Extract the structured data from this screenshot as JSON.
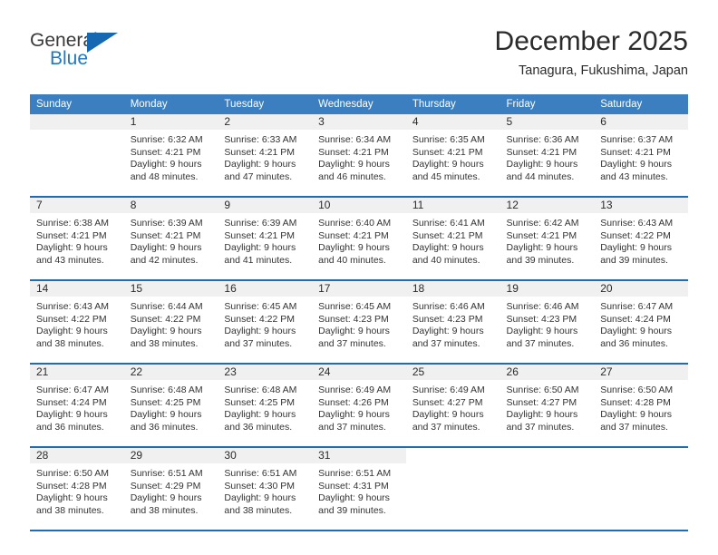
{
  "brand": {
    "name_part1": "General",
    "name_part2": "Blue",
    "logo_icon": "triangle-flag-icon"
  },
  "header": {
    "title": "December 2025",
    "subtitle": "Tanagura, Fukushima, Japan"
  },
  "colors": {
    "header_blue": "#3c7fc1",
    "row_divider_blue": "#1f6cb0",
    "daynum_band": "#f0f0f0",
    "brand_blue": "#1f78c1"
  },
  "weekday_headers": [
    "Sunday",
    "Monday",
    "Tuesday",
    "Wednesday",
    "Thursday",
    "Friday",
    "Saturday"
  ],
  "weeks": [
    [
      {
        "day": "",
        "lines": []
      },
      {
        "day": "1",
        "lines": [
          "Sunrise: 6:32 AM",
          "Sunset: 4:21 PM",
          "Daylight: 9 hours",
          "and 48 minutes."
        ]
      },
      {
        "day": "2",
        "lines": [
          "Sunrise: 6:33 AM",
          "Sunset: 4:21 PM",
          "Daylight: 9 hours",
          "and 47 minutes."
        ]
      },
      {
        "day": "3",
        "lines": [
          "Sunrise: 6:34 AM",
          "Sunset: 4:21 PM",
          "Daylight: 9 hours",
          "and 46 minutes."
        ]
      },
      {
        "day": "4",
        "lines": [
          "Sunrise: 6:35 AM",
          "Sunset: 4:21 PM",
          "Daylight: 9 hours",
          "and 45 minutes."
        ]
      },
      {
        "day": "5",
        "lines": [
          "Sunrise: 6:36 AM",
          "Sunset: 4:21 PM",
          "Daylight: 9 hours",
          "and 44 minutes."
        ]
      },
      {
        "day": "6",
        "lines": [
          "Sunrise: 6:37 AM",
          "Sunset: 4:21 PM",
          "Daylight: 9 hours",
          "and 43 minutes."
        ]
      }
    ],
    [
      {
        "day": "7",
        "lines": [
          "Sunrise: 6:38 AM",
          "Sunset: 4:21 PM",
          "Daylight: 9 hours",
          "and 43 minutes."
        ]
      },
      {
        "day": "8",
        "lines": [
          "Sunrise: 6:39 AM",
          "Sunset: 4:21 PM",
          "Daylight: 9 hours",
          "and 42 minutes."
        ]
      },
      {
        "day": "9",
        "lines": [
          "Sunrise: 6:39 AM",
          "Sunset: 4:21 PM",
          "Daylight: 9 hours",
          "and 41 minutes."
        ]
      },
      {
        "day": "10",
        "lines": [
          "Sunrise: 6:40 AM",
          "Sunset: 4:21 PM",
          "Daylight: 9 hours",
          "and 40 minutes."
        ]
      },
      {
        "day": "11",
        "lines": [
          "Sunrise: 6:41 AM",
          "Sunset: 4:21 PM",
          "Daylight: 9 hours",
          "and 40 minutes."
        ]
      },
      {
        "day": "12",
        "lines": [
          "Sunrise: 6:42 AM",
          "Sunset: 4:21 PM",
          "Daylight: 9 hours",
          "and 39 minutes."
        ]
      },
      {
        "day": "13",
        "lines": [
          "Sunrise: 6:43 AM",
          "Sunset: 4:22 PM",
          "Daylight: 9 hours",
          "and 39 minutes."
        ]
      }
    ],
    [
      {
        "day": "14",
        "lines": [
          "Sunrise: 6:43 AM",
          "Sunset: 4:22 PM",
          "Daylight: 9 hours",
          "and 38 minutes."
        ]
      },
      {
        "day": "15",
        "lines": [
          "Sunrise: 6:44 AM",
          "Sunset: 4:22 PM",
          "Daylight: 9 hours",
          "and 38 minutes."
        ]
      },
      {
        "day": "16",
        "lines": [
          "Sunrise: 6:45 AM",
          "Sunset: 4:22 PM",
          "Daylight: 9 hours",
          "and 37 minutes."
        ]
      },
      {
        "day": "17",
        "lines": [
          "Sunrise: 6:45 AM",
          "Sunset: 4:23 PM",
          "Daylight: 9 hours",
          "and 37 minutes."
        ]
      },
      {
        "day": "18",
        "lines": [
          "Sunrise: 6:46 AM",
          "Sunset: 4:23 PM",
          "Daylight: 9 hours",
          "and 37 minutes."
        ]
      },
      {
        "day": "19",
        "lines": [
          "Sunrise: 6:46 AM",
          "Sunset: 4:23 PM",
          "Daylight: 9 hours",
          "and 37 minutes."
        ]
      },
      {
        "day": "20",
        "lines": [
          "Sunrise: 6:47 AM",
          "Sunset: 4:24 PM",
          "Daylight: 9 hours",
          "and 36 minutes."
        ]
      }
    ],
    [
      {
        "day": "21",
        "lines": [
          "Sunrise: 6:47 AM",
          "Sunset: 4:24 PM",
          "Daylight: 9 hours",
          "and 36 minutes."
        ]
      },
      {
        "day": "22",
        "lines": [
          "Sunrise: 6:48 AM",
          "Sunset: 4:25 PM",
          "Daylight: 9 hours",
          "and 36 minutes."
        ]
      },
      {
        "day": "23",
        "lines": [
          "Sunrise: 6:48 AM",
          "Sunset: 4:25 PM",
          "Daylight: 9 hours",
          "and 36 minutes."
        ]
      },
      {
        "day": "24",
        "lines": [
          "Sunrise: 6:49 AM",
          "Sunset: 4:26 PM",
          "Daylight: 9 hours",
          "and 37 minutes."
        ]
      },
      {
        "day": "25",
        "lines": [
          "Sunrise: 6:49 AM",
          "Sunset: 4:27 PM",
          "Daylight: 9 hours",
          "and 37 minutes."
        ]
      },
      {
        "day": "26",
        "lines": [
          "Sunrise: 6:50 AM",
          "Sunset: 4:27 PM",
          "Daylight: 9 hours",
          "and 37 minutes."
        ]
      },
      {
        "day": "27",
        "lines": [
          "Sunrise: 6:50 AM",
          "Sunset: 4:28 PM",
          "Daylight: 9 hours",
          "and 37 minutes."
        ]
      }
    ],
    [
      {
        "day": "28",
        "lines": [
          "Sunrise: 6:50 AM",
          "Sunset: 4:28 PM",
          "Daylight: 9 hours",
          "and 38 minutes."
        ]
      },
      {
        "day": "29",
        "lines": [
          "Sunrise: 6:51 AM",
          "Sunset: 4:29 PM",
          "Daylight: 9 hours",
          "and 38 minutes."
        ]
      },
      {
        "day": "30",
        "lines": [
          "Sunrise: 6:51 AM",
          "Sunset: 4:30 PM",
          "Daylight: 9 hours",
          "and 38 minutes."
        ]
      },
      {
        "day": "31",
        "lines": [
          "Sunrise: 6:51 AM",
          "Sunset: 4:31 PM",
          "Daylight: 9 hours",
          "and 39 minutes."
        ]
      },
      {
        "day": "",
        "lines": []
      },
      {
        "day": "",
        "lines": []
      },
      {
        "day": "",
        "lines": []
      }
    ]
  ]
}
